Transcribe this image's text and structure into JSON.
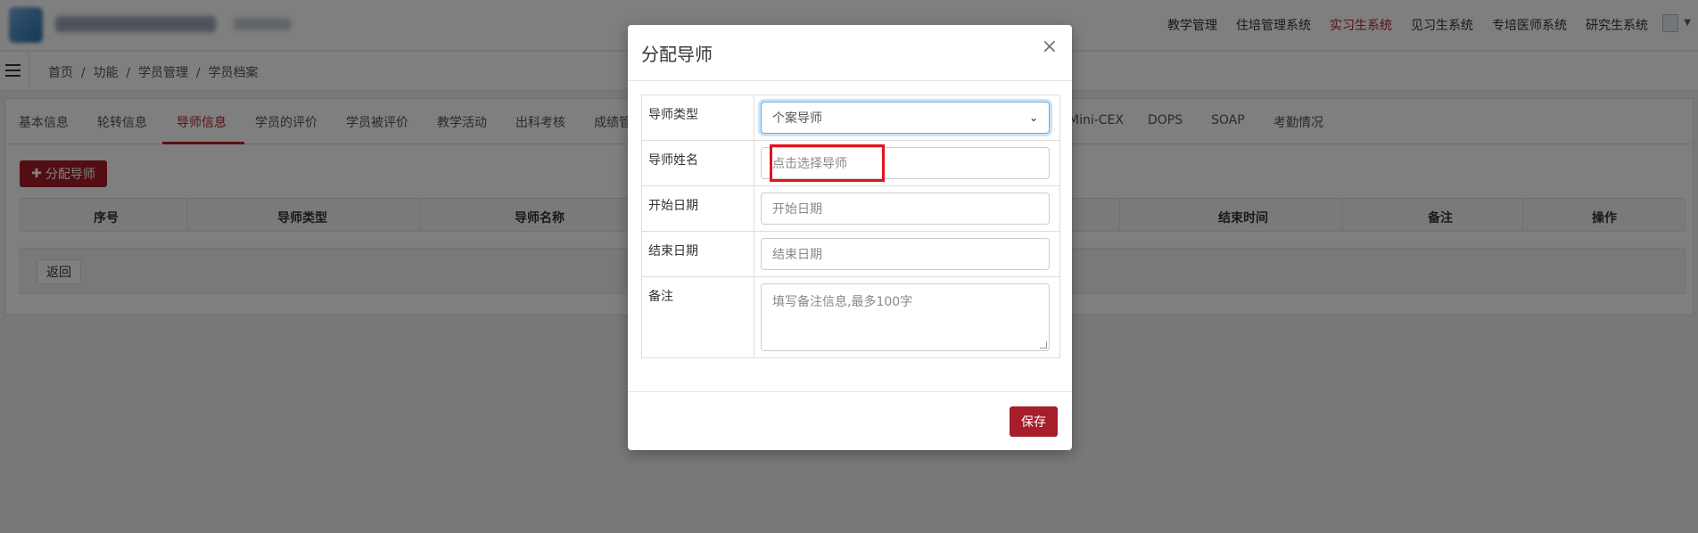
{
  "top_nav": {
    "system_menu": [
      {
        "label": "教学管理",
        "active": false
      },
      {
        "label": "住培管理系统",
        "active": false
      },
      {
        "label": "实习生系统",
        "active": true
      },
      {
        "label": "见习生系统",
        "active": false
      },
      {
        "label": "专培医师系统",
        "active": false
      },
      {
        "label": "研究生系统",
        "active": false
      }
    ]
  },
  "breadcrumb": "首页  /  功能  /  学员管理  /  学员档案",
  "tabs": [
    "基本信息",
    "轮转信息",
    "导师信息",
    "学员的评价",
    "学员被评价",
    "教学活动",
    "出科考核",
    "成绩管",
    "Mini-CEX",
    "DOPS",
    "SOAP",
    "考勤情况"
  ],
  "active_tab": "导师信息",
  "toolbar": {
    "assign_label": "分配导师"
  },
  "table": {
    "columns": [
      "序号",
      "导师类型",
      "导师名称",
      "结束时间",
      "备注",
      "操作"
    ]
  },
  "footer": {
    "back_label": "返回"
  },
  "modal": {
    "title": "分配导师",
    "close_glyph": "×",
    "fields": {
      "type": {
        "label": "导师类型",
        "value": "个案导师"
      },
      "name": {
        "label": "导师姓名",
        "placeholder": "点击选择导师"
      },
      "start": {
        "label": "开始日期",
        "placeholder": "开始日期"
      },
      "end": {
        "label": "结束日期",
        "placeholder": "结束日期"
      },
      "remark": {
        "label": "备注",
        "placeholder": "填写备注信息,最多100字"
      }
    },
    "save_label": "保存"
  },
  "colors": {
    "accent": "#a71d2a",
    "active_text": "#b0202c",
    "highlight": "#e0141b",
    "overlay": "rgba(0,0,0,0.5)"
  }
}
